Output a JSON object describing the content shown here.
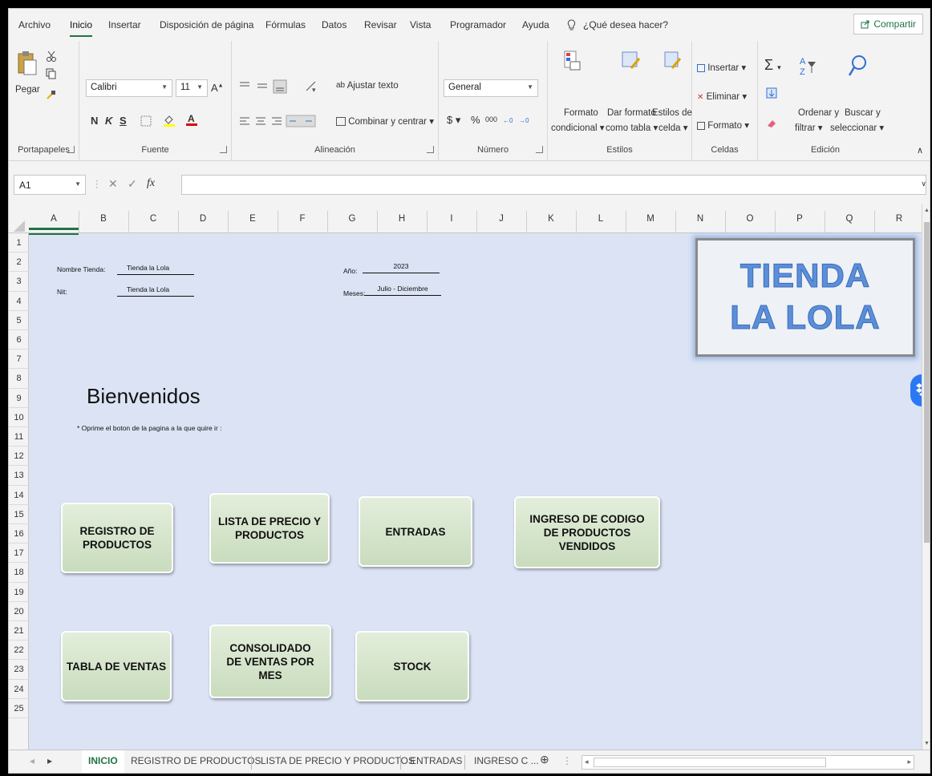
{
  "menu": {
    "items": [
      "Archivo",
      "Inicio",
      "Insertar",
      "Disposición de página",
      "Fórmulas",
      "Datos",
      "Revisar",
      "Vista",
      "Programador",
      "Ayuda"
    ],
    "active": "Inicio",
    "tell_me": "¿Qué desea hacer?",
    "share": "Compartir"
  },
  "ribbon": {
    "clipboard": {
      "paste": "Pegar",
      "label": "Portapapeles"
    },
    "font": {
      "name": "Calibri",
      "size": "11",
      "bold": "N",
      "italic": "K",
      "underline": "S",
      "label": "Fuente"
    },
    "alignment": {
      "wrap": "Ajustar texto",
      "merge": "Combinar y centrar",
      "label": "Alineación"
    },
    "number": {
      "format": "General",
      "currency": "$",
      "percent": "%",
      "thousands": "000",
      "label": "Número"
    },
    "styles": {
      "conditional_1": "Formato",
      "conditional_2": "condicional",
      "table_1": "Dar formato",
      "table_2": "como tabla",
      "cell_1": "Estilos de",
      "cell_2": "celda",
      "label": "Estilos"
    },
    "cells": {
      "insert": "Insertar",
      "delete": "Eliminar",
      "format": "Formato",
      "label": "Celdas"
    },
    "editing": {
      "sort_1": "Ordenar y",
      "sort_2": "filtrar",
      "find_1": "Buscar y",
      "find_2": "seleccionar",
      "label": "Edición"
    }
  },
  "formula_bar": {
    "name_box": "A1",
    "fx": "fx",
    "value": ""
  },
  "columns": [
    "A",
    "B",
    "C",
    "D",
    "E",
    "F",
    "G",
    "H",
    "I",
    "J",
    "K",
    "L",
    "M",
    "N",
    "O",
    "P",
    "Q",
    "R"
  ],
  "rows": [
    "1",
    "2",
    "3",
    "4",
    "5",
    "6",
    "7",
    "8",
    "9",
    "10",
    "11",
    "12",
    "13",
    "14",
    "15",
    "16",
    "17",
    "18",
    "19",
    "20",
    "21",
    "22",
    "23",
    "24",
    "25"
  ],
  "sheet": {
    "store_label": "Nombre Tienda:",
    "store_value": "Tienda la Lola",
    "nit_label": "Nit:",
    "nit_value": "Tienda la Lola",
    "year_label": "Año:",
    "year_value": "2023",
    "months_label": "Meses:",
    "months_value": "Julio - Diciembre",
    "welcome": "Bienvenidos",
    "instruction": "* Oprime el boton de la pagina a la que quire ir :",
    "logo_line1": "TIENDA",
    "logo_line2": "LA LOLA",
    "buttons": {
      "registro": "REGISTRO DE PRODUCTOS",
      "lista": "LISTA DE PRECIO Y PRODUCTOS",
      "entradas": "ENTRADAS",
      "ingreso": "INGRESO DE CODIGO DE PRODUCTOS VENDIDOS",
      "tabla": "TABLA DE VENTAS",
      "consolidado": "CONSOLIDADO DE VENTAS POR MES",
      "stock": "STOCK"
    }
  },
  "tabs": [
    "INICIO",
    "REGISTRO DE PRODUCTOS",
    "LISTA DE PRECIO Y PRODUCTOS",
    "ENTRADAS",
    "INGRESO C ..."
  ],
  "colors": {
    "excel_green": "#217346",
    "sheet_bg": "#dbe3f4",
    "button_green": "#d4e4c8",
    "logo_blue": "#5b8fd9"
  }
}
